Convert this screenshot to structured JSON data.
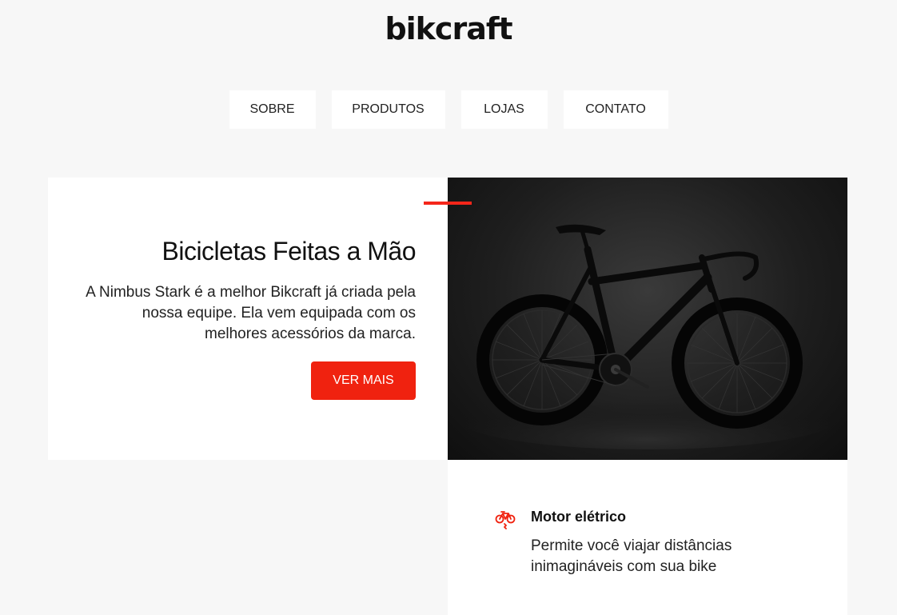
{
  "header": {
    "logo": "bikcraft"
  },
  "nav": {
    "items": [
      {
        "label": "Sobre"
      },
      {
        "label": "Produtos"
      },
      {
        "label": "Lojas"
      },
      {
        "label": "Contato"
      }
    ]
  },
  "hero": {
    "title": "Bicicletas Feitas a Mão",
    "description": "A Nimbus Stark é a melhor Bikcraft já criada pela nossa equipe. Ela vem equipada com os melhores acessórios da marca.",
    "button_label": "Ver Mais",
    "image_icon": "bicycle-photo"
  },
  "feature": {
    "icon": "electric-bike-icon",
    "title": "Motor elétrico",
    "description": "Permite você viajar distâncias inimagináveis com sua bike"
  },
  "colors": {
    "accent": "#f0220f",
    "background": "#f7f7f7",
    "text": "#111111"
  }
}
